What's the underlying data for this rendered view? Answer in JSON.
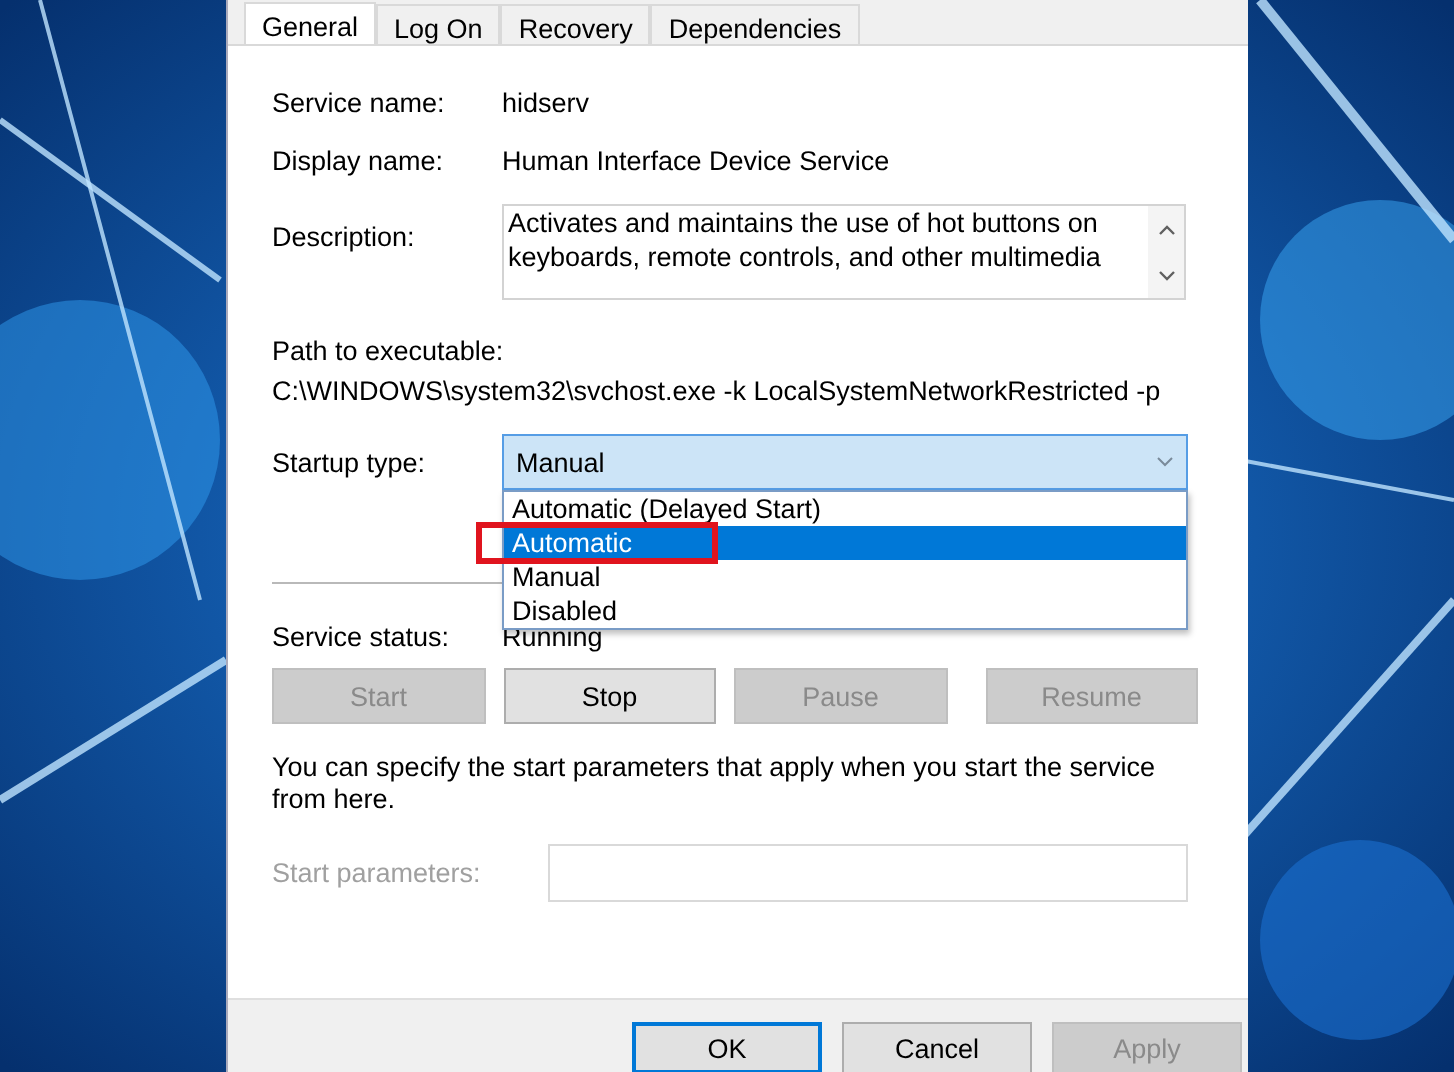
{
  "tabs": [
    {
      "label": "General",
      "selected": true
    },
    {
      "label": "Log On",
      "selected": false
    },
    {
      "label": "Recovery",
      "selected": false
    },
    {
      "label": "Dependencies",
      "selected": false
    }
  ],
  "info": [
    {
      "label": "Service name:",
      "value": "hidserv"
    },
    {
      "label": "Display name:",
      "value": "Human Interface Device Service"
    }
  ],
  "description": {
    "label": "Description:",
    "value": "Activates and maintains the use of hot buttons on keyboards, remote controls, and other multimedia"
  },
  "path": {
    "label": "Path to executable:",
    "value": "C:\\WINDOWS\\system32\\svchost.exe -k LocalSystemNetworkRestricted -p"
  },
  "startup_type": {
    "label": "Startup type:",
    "value": "Manual",
    "expanded": true,
    "options": [
      {
        "label": "Automatic (Delayed Start)",
        "highlighted": false
      },
      {
        "label": "Automatic",
        "highlighted": true
      },
      {
        "label": "Manual",
        "highlighted": false
      },
      {
        "label": "Disabled",
        "highlighted": false
      }
    ]
  },
  "service_status": {
    "label": "Service status:",
    "value": "Running"
  },
  "service_buttons": [
    {
      "label": "Start",
      "disabled": true
    },
    {
      "label": "Stop",
      "disabled": false
    },
    {
      "label": "Pause",
      "disabled": true
    },
    {
      "label": "Resume",
      "disabled": true
    }
  ],
  "note": "You can specify the start parameters that apply when you start the service from here.",
  "start_parameters": {
    "label": "Start parameters:",
    "disabled": true
  },
  "footer_buttons": [
    {
      "label": "OK",
      "disabled": false,
      "default": true
    },
    {
      "label": "Cancel",
      "disabled": false,
      "default": false
    },
    {
      "label": "Apply",
      "disabled": true,
      "default": false
    }
  ]
}
